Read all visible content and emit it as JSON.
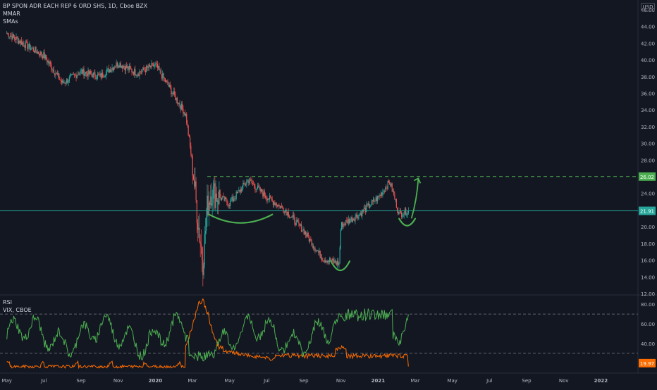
{
  "chart_data": [
    {
      "type": "candlestick",
      "title": "BP SPON ADR EACH REP 6 ORD SHS, 1D, Cboe BZX",
      "indicators": [
        "MMAR",
        "SMAs"
      ],
      "currency": "USD",
      "y_ticks": [
        "46.00",
        "44.00",
        "42.00",
        "40.00",
        "38.00",
        "36.00",
        "34.00",
        "32.00",
        "30.00",
        "28.00",
        "24.00",
        "22.00",
        "20.00",
        "18.00",
        "16.00",
        "14.00",
        "12.00"
      ],
      "ylim": [
        12,
        46.5
      ],
      "x_ticks": [
        "May",
        "Jul",
        "Sep",
        "Nov",
        "2020",
        "Mar",
        "May",
        "Jul",
        "Sep",
        "Nov",
        "2021",
        "Mar",
        "May",
        "Jul",
        "Sep",
        "Nov",
        "2022"
      ],
      "price_path": [
        [
          "2019-05",
          43.2
        ],
        [
          "2019-06",
          41.8
        ],
        [
          "2019-07",
          40.5
        ],
        [
          "2019-08",
          37.2
        ],
        [
          "2019-09",
          38.6
        ],
        [
          "2019-10",
          38.0
        ],
        [
          "2019-11",
          39.6
        ],
        [
          "2019-12",
          38.4
        ],
        [
          "2020-01",
          39.4
        ],
        [
          "2020-02",
          35.8
        ],
        [
          "2020-02-20",
          33.5
        ],
        [
          "2020-03-01",
          27.5
        ],
        [
          "2020-03-10",
          20.5
        ],
        [
          "2020-03-18",
          15.8
        ],
        [
          "2020-03-25",
          22.5
        ],
        [
          "2020-04",
          24.2
        ],
        [
          "2020-05",
          22.8
        ],
        [
          "2020-06",
          25.6
        ],
        [
          "2020-07",
          23.6
        ],
        [
          "2020-08",
          22.0
        ],
        [
          "2020-09",
          19.5
        ],
        [
          "2020-10",
          16.2
        ],
        [
          "2020-10-28",
          15.6
        ],
        [
          "2020-11",
          20.2
        ],
        [
          "2020-12",
          21.5
        ],
        [
          "2021-01",
          23.5
        ],
        [
          "2021-01-20",
          25.4
        ],
        [
          "2021-02-05",
          21.5
        ],
        [
          "2021-02-20",
          21.9
        ]
      ],
      "horizontal_lines": [
        {
          "label": "26.02",
          "value": 26.02,
          "style": "dashed",
          "color": "#4caf50"
        },
        {
          "label": "21.91",
          "value": 21.91,
          "style": "solid",
          "color": "#26a69a"
        }
      ],
      "ma_lines": [
        {
          "color": "#ffb74d"
        },
        {
          "color": "#c62828"
        },
        {
          "color": "#26a69a"
        }
      ],
      "annotations": [
        "cup-left",
        "cup-middle",
        "cup-right",
        "arrow-up"
      ]
    },
    {
      "type": "line",
      "legend": [
        "RSI",
        "VIX, CBOE"
      ],
      "y_ticks": [
        "80.00",
        "60.00",
        "40.00"
      ],
      "ylim": [
        17,
        88
      ],
      "hlines": [
        70,
        30
      ],
      "series": [
        {
          "name": "RSI",
          "color": "#4caf50"
        },
        {
          "name": "VIX, CBOE",
          "color": "#ff6d00"
        }
      ],
      "vix_label": "19.97"
    }
  ],
  "colors": {
    "background": "#131722",
    "up": "#26a69a",
    "down": "#ef5350",
    "text": "#b2b5be"
  }
}
